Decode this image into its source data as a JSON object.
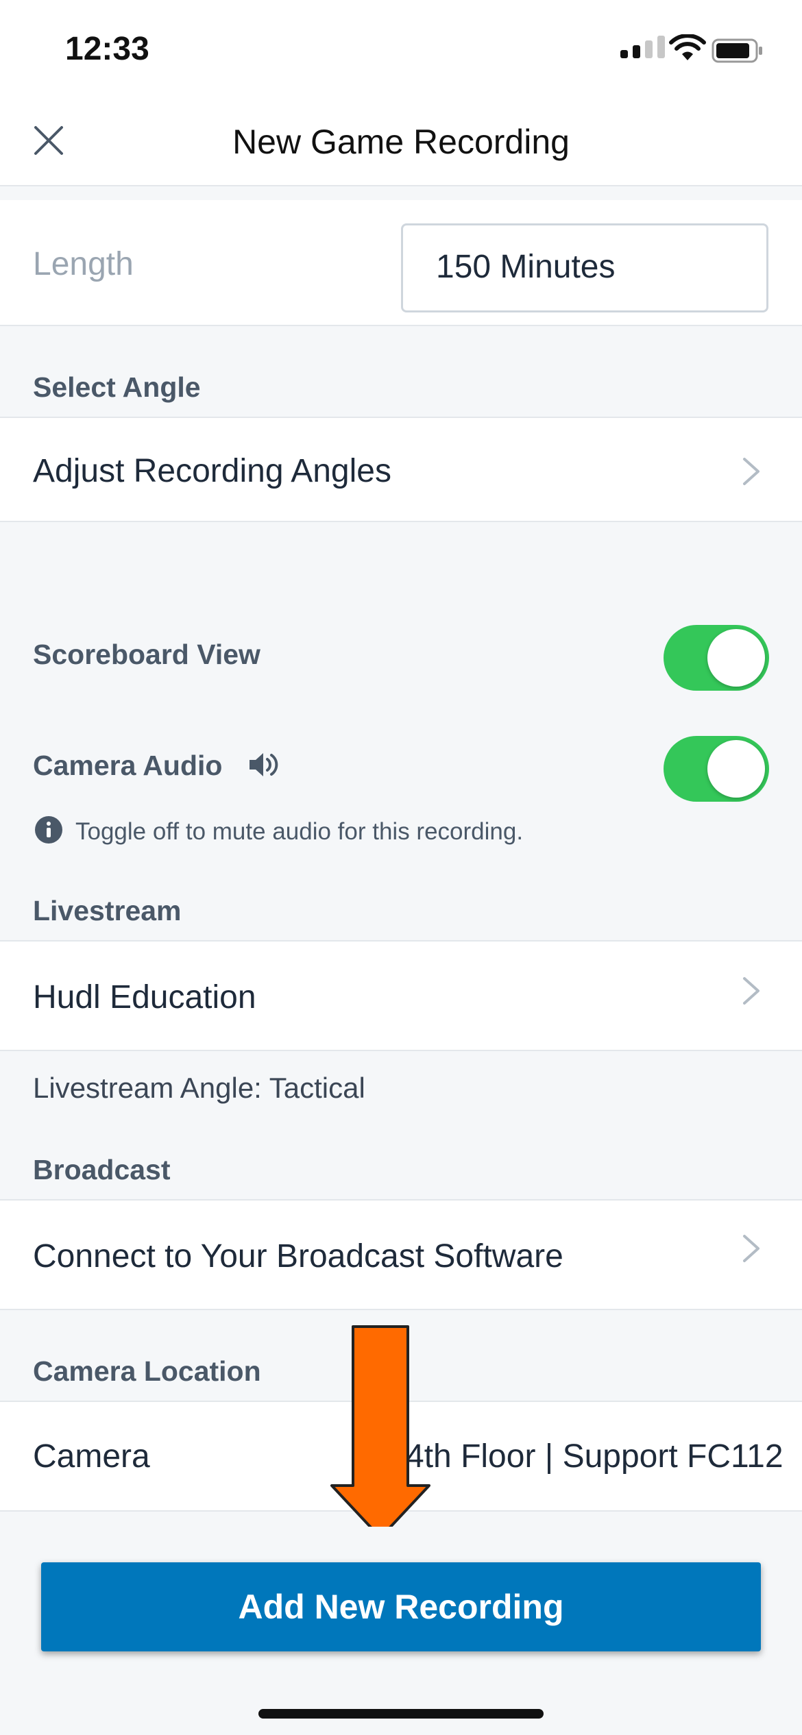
{
  "status": {
    "time": "12:33"
  },
  "nav": {
    "title": "New Game Recording",
    "close_icon": "close-icon"
  },
  "length": {
    "label": "Length",
    "value": "150 Minutes"
  },
  "select_angle": {
    "header": "Select Angle",
    "row_label": "Adjust Recording Angles"
  },
  "scoreboard": {
    "label": "Scoreboard View",
    "enabled": true
  },
  "camera_audio": {
    "label": "Camera Audio",
    "enabled": true,
    "icon": "speaker-icon",
    "hint": "Toggle off to mute audio for this recording."
  },
  "livestream": {
    "header": "Livestream",
    "row_label": "Hudl Education",
    "angle_text": "Livestream Angle: Tactical"
  },
  "broadcast": {
    "header": "Broadcast",
    "row_label": "Connect to Your Broadcast Software"
  },
  "camera_location": {
    "header": "Camera Location",
    "row_label": "Camera",
    "value": "4th Floor | Support FC112"
  },
  "primary_action": {
    "label": "Add New Recording"
  },
  "colors": {
    "toggle_on": "#34c759",
    "primary": "#0077bb",
    "annotation_arrow": "#ff6a00"
  }
}
